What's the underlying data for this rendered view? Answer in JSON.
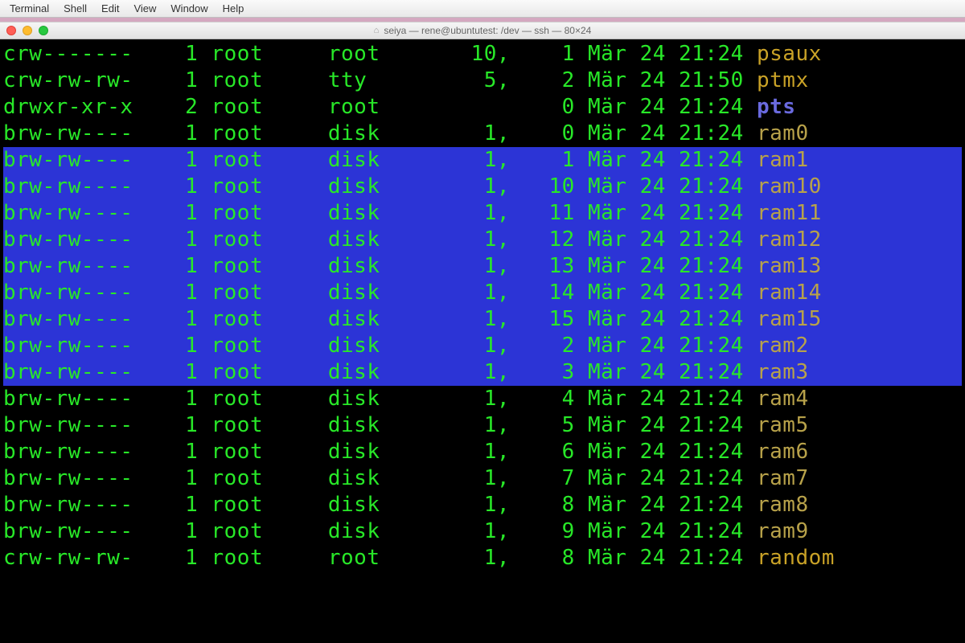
{
  "menubar": {
    "items": [
      "Terminal",
      "Shell",
      "Edit",
      "View",
      "Window",
      "Help"
    ]
  },
  "window": {
    "title": "seiya — rene@ubuntutest: /dev — ssh — 80×24"
  },
  "rows": [
    {
      "sel": false,
      "perm": "crw-------",
      "links": "1",
      "user": "root",
      "group": "root",
      "maj": "10,",
      "min": "1",
      "date": "Mär 24 21:24",
      "name": "psaux",
      "nclass": "c-name-yellow"
    },
    {
      "sel": false,
      "perm": "crw-rw-rw-",
      "links": "1",
      "user": "root",
      "group": "tty",
      "maj": "5,",
      "min": "2",
      "date": "Mär 24 21:50",
      "name": "ptmx",
      "nclass": "c-name-yellow"
    },
    {
      "sel": false,
      "perm": "drwxr-xr-x",
      "links": "2",
      "user": "root",
      "group": "root",
      "maj": "",
      "min": "0",
      "date": "Mär 24 21:24",
      "name": "pts",
      "nclass": "c-name-blue"
    },
    {
      "sel": false,
      "perm": "brw-rw----",
      "links": "1",
      "user": "root",
      "group": "disk",
      "maj": "1,",
      "min": "0",
      "date": "Mär 24 21:24",
      "name": "ram0",
      "nclass": "c-name-olive"
    },
    {
      "sel": true,
      "perm": "brw-rw----",
      "links": "1",
      "user": "root",
      "group": "disk",
      "maj": "1,",
      "min": "1",
      "date": "Mär 24 21:24",
      "name": "ram1",
      "nclass": "c-name-olive"
    },
    {
      "sel": true,
      "perm": "brw-rw----",
      "links": "1",
      "user": "root",
      "group": "disk",
      "maj": "1,",
      "min": "10",
      "date": "Mär 24 21:24",
      "name": "ram10",
      "nclass": "c-name-olive"
    },
    {
      "sel": true,
      "perm": "brw-rw----",
      "links": "1",
      "user": "root",
      "group": "disk",
      "maj": "1,",
      "min": "11",
      "date": "Mär 24 21:24",
      "name": "ram11",
      "nclass": "c-name-olive"
    },
    {
      "sel": true,
      "perm": "brw-rw----",
      "links": "1",
      "user": "root",
      "group": "disk",
      "maj": "1,",
      "min": "12",
      "date": "Mär 24 21:24",
      "name": "ram12",
      "nclass": "c-name-olive"
    },
    {
      "sel": true,
      "perm": "brw-rw----",
      "links": "1",
      "user": "root",
      "group": "disk",
      "maj": "1,",
      "min": "13",
      "date": "Mär 24 21:24",
      "name": "ram13",
      "nclass": "c-name-olive"
    },
    {
      "sel": true,
      "perm": "brw-rw----",
      "links": "1",
      "user": "root",
      "group": "disk",
      "maj": "1,",
      "min": "14",
      "date": "Mär 24 21:24",
      "name": "ram14",
      "nclass": "c-name-olive"
    },
    {
      "sel": true,
      "perm": "brw-rw----",
      "links": "1",
      "user": "root",
      "group": "disk",
      "maj": "1,",
      "min": "15",
      "date": "Mär 24 21:24",
      "name": "ram15",
      "nclass": "c-name-olive"
    },
    {
      "sel": true,
      "perm": "brw-rw----",
      "links": "1",
      "user": "root",
      "group": "disk",
      "maj": "1,",
      "min": "2",
      "date": "Mär 24 21:24",
      "name": "ram2",
      "nclass": "c-name-olive"
    },
    {
      "sel": true,
      "perm": "brw-rw----",
      "links": "1",
      "user": "root",
      "group": "disk",
      "maj": "1,",
      "min": "3",
      "date": "Mär 24 21:24",
      "name": "ram3",
      "nclass": "c-name-olive"
    },
    {
      "sel": false,
      "perm": "brw-rw----",
      "links": "1",
      "user": "root",
      "group": "disk",
      "maj": "1,",
      "min": "4",
      "date": "Mär 24 21:24",
      "name": "ram4",
      "nclass": "c-name-olive"
    },
    {
      "sel": false,
      "perm": "brw-rw----",
      "links": "1",
      "user": "root",
      "group": "disk",
      "maj": "1,",
      "min": "5",
      "date": "Mär 24 21:24",
      "name": "ram5",
      "nclass": "c-name-olive"
    },
    {
      "sel": false,
      "perm": "brw-rw----",
      "links": "1",
      "user": "root",
      "group": "disk",
      "maj": "1,",
      "min": "6",
      "date": "Mär 24 21:24",
      "name": "ram6",
      "nclass": "c-name-olive"
    },
    {
      "sel": false,
      "perm": "brw-rw----",
      "links": "1",
      "user": "root",
      "group": "disk",
      "maj": "1,",
      "min": "7",
      "date": "Mär 24 21:24",
      "name": "ram7",
      "nclass": "c-name-olive"
    },
    {
      "sel": false,
      "perm": "brw-rw----",
      "links": "1",
      "user": "root",
      "group": "disk",
      "maj": "1,",
      "min": "8",
      "date": "Mär 24 21:24",
      "name": "ram8",
      "nclass": "c-name-olive"
    },
    {
      "sel": false,
      "perm": "brw-rw----",
      "links": "1",
      "user": "root",
      "group": "disk",
      "maj": "1,",
      "min": "9",
      "date": "Mär 24 21:24",
      "name": "ram9",
      "nclass": "c-name-olive"
    },
    {
      "sel": false,
      "perm": "crw-rw-rw-",
      "links": "1",
      "user": "root",
      "group": "root",
      "maj": "1,",
      "min": "8",
      "date": "Mär 24 21:24",
      "name": "random",
      "nclass": "c-name-yellow"
    }
  ]
}
